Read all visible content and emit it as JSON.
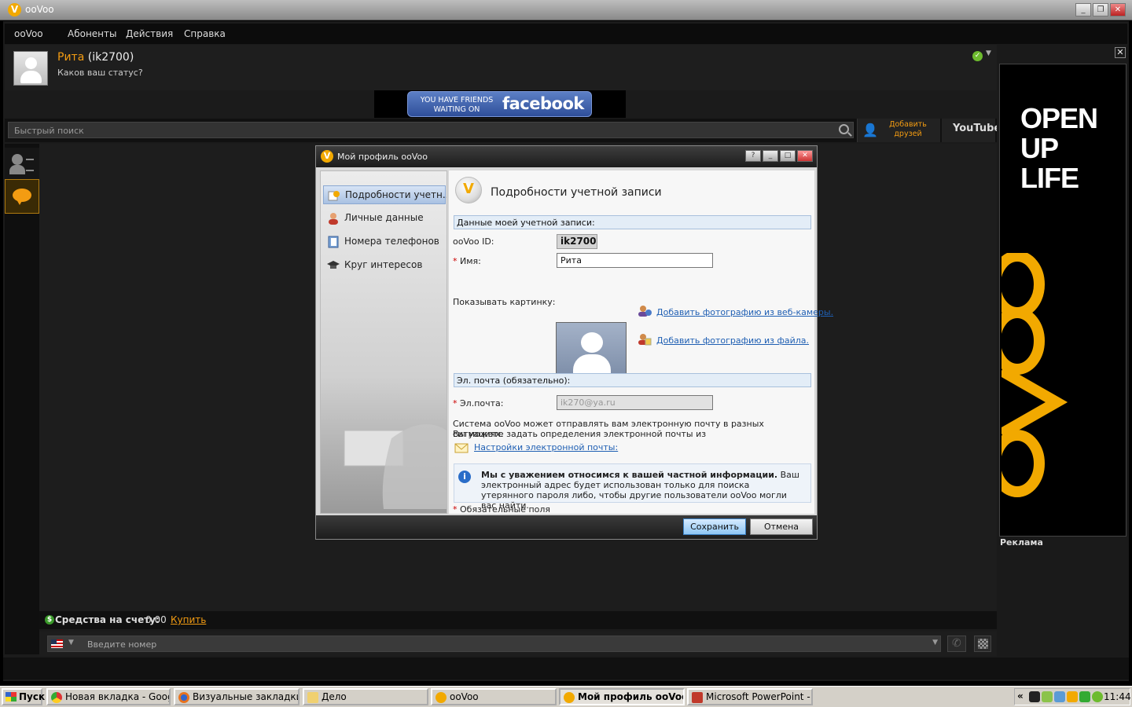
{
  "window": {
    "title": "ooVoo",
    "logo": "V"
  },
  "menu": [
    "ooVoo",
    "Абоненты",
    "Действия",
    "Справка"
  ],
  "user": {
    "name": "Рита",
    "id": "(ik2700)",
    "status_prompt": "Каков ваш статус?"
  },
  "facebook_banner": {
    "small": "YOU HAVE FRIENDS WAITING ON",
    "brand": "facebook"
  },
  "search": {
    "placeholder": "Быстрый поиск"
  },
  "add_friends": "Добавить друзей",
  "youtube": "YouTube",
  "balance": {
    "label": "Средства на счету:",
    "value": "0,00",
    "buy": "Купить"
  },
  "dial": {
    "placeholder": "Введите номер"
  },
  "ad": {
    "text": "OPEN UP LIFE",
    "brand": "ooVoo",
    "label": "Реклама",
    "brand_color": "#f2a900"
  },
  "dialog": {
    "title": "Мой профиль ooVoo",
    "nav": [
      {
        "label": "Подробности учетн...",
        "icon": "account-details-icon"
      },
      {
        "label": "Личные данные",
        "icon": "personal-data-icon"
      },
      {
        "label": "Номера телефонов",
        "icon": "phone-book-icon"
      },
      {
        "label": "Круг интересов",
        "icon": "graduation-cap-icon"
      }
    ],
    "header": "Подробности учетной записи",
    "section_account": "Данные моей учетной записи:",
    "oovoo_id_label": "ooVoo ID:",
    "oovoo_id_value": "ik2700",
    "required_mark": "*",
    "name_label": "Имя:",
    "name_value": "Рита",
    "show_picture_label": "Показывать картинку:",
    "add_webcam_photo": "Добавить фотографию из веб-камеры.",
    "add_file_photo": "Добавить фотографию из файла.",
    "section_email": "Эл. почта (обязательно):",
    "email_label": "Эл.почта:",
    "email_value": "ik270@ya.ru",
    "email_note_1": "Система ooVoo может отправлять вам электронную почту в разных ситуациях.",
    "email_note_2": "Вы можете задать определения электронной почты из",
    "email_settings_link": "Настройки электронной почты:",
    "privacy_bold": "Мы с уважением относимся к вашей частной информации.",
    "privacy_rest": " Ваш электронный адрес будет использован только для поиска утерянного пароля либо, чтобы другие пользователи ooVoo могли вас найти.",
    "required_fields": "Обязательные поля",
    "save": "Сохранить",
    "cancel": "Отмена"
  },
  "taskbar": {
    "start": "Пуск",
    "items": [
      {
        "label": "Новая вкладка - Google ...",
        "icon": "chrome-icon"
      },
      {
        "label": "Визуальные закладки - ...",
        "icon": "firefox-icon"
      },
      {
        "label": "Дело",
        "icon": "folder-icon"
      },
      {
        "label": "ooVoo",
        "icon": "oovoo-icon"
      },
      {
        "label": "Мой профиль ooVoo",
        "icon": "oovoo-icon",
        "active": true
      },
      {
        "label": "Microsoft PowerPoint - [П...",
        "icon": "powerpoint-icon"
      }
    ],
    "tray_arrow": "«",
    "clock": "11:44"
  }
}
